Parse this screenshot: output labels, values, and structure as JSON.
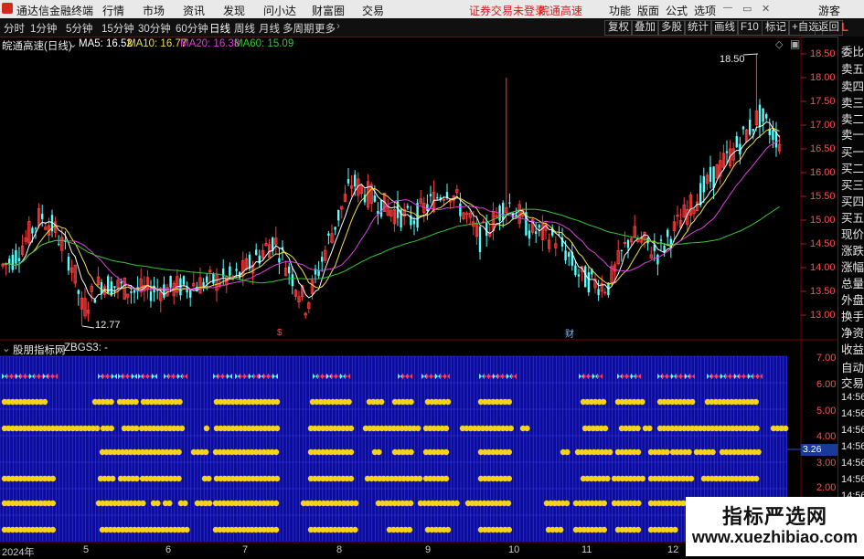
{
  "menubar": {
    "app_title": "通达信金融终端",
    "menus": [
      "行情",
      "市场",
      "资讯",
      "发现",
      "问小达",
      "财富圈",
      "交易"
    ],
    "warning": "证券交易未登录",
    "stock_tab": "皖通高速",
    "right_menus": [
      "功能",
      "版面",
      "公式",
      "选项"
    ],
    "guest": "游客"
  },
  "toolbar": {
    "periods": [
      "分时",
      "1分钟",
      "5分钟",
      "15分钟",
      "30分钟",
      "60分钟",
      "日线",
      "周线",
      "月线",
      "多周期",
      "更多"
    ],
    "active": "日线",
    "right_buttons": [
      "复权",
      "叠加",
      "多股",
      "统计",
      "画线",
      "F10",
      "标记",
      "+自选",
      "返回"
    ]
  },
  "chart": {
    "stock_label": "皖通高速(日线)",
    "ma": [
      {
        "text": "MA5: 16.52",
        "color": "#ffffff"
      },
      {
        "text": "MA10: 16.77",
        "color": "#f2e14a"
      },
      {
        "text": "MA20: 16.38",
        "color": "#e040e0"
      },
      {
        "text": "MA60: 15.09",
        "color": "#38c838"
      }
    ],
    "price_axis": [
      "18.50",
      "18.00",
      "17.50",
      "17.00",
      "16.50",
      "16.00",
      "15.50",
      "15.00",
      "14.50",
      "14.00",
      "13.50",
      "13.00"
    ],
    "high_label": "18.50",
    "low_label": "12.77",
    "event_markers": [
      "$",
      "财"
    ],
    "colors": {
      "up": "#ff3c3c",
      "down": "#54ffff",
      "ma5": "#ffffff",
      "ma10": "#f2e14a",
      "ma20": "#e040e0",
      "ma60": "#38c838",
      "grid": "#7a0000"
    }
  },
  "indicator": {
    "title": "股朋指标网",
    "formula": "ZBGS3: -",
    "axis": [
      "7.00",
      "6.00",
      "5.00",
      "4.00",
      "3.00",
      "2.00"
    ],
    "current_value": "3.26"
  },
  "x_axis": [
    "2024年",
    "5",
    "6",
    "7",
    "8",
    "9",
    "10",
    "11",
    "12"
  ],
  "side_panel": {
    "items": [
      "委比",
      "卖五",
      "卖四",
      "卖三",
      "卖二",
      "卖一",
      "买一",
      "买二",
      "买三",
      "买四",
      "买五",
      "现价",
      "涨跌",
      "涨幅",
      "总量",
      "外盘",
      "换手",
      "净资",
      "收益",
      "自动",
      "交易"
    ],
    "times": [
      "14:56",
      "14:56",
      "14:56",
      "14:56",
      "14:56",
      "14:56",
      "14:56"
    ],
    "corner_letter": "L"
  },
  "watermark": {
    "line1": "指标严选网",
    "line2": "www.xuezhibiao.com"
  }
}
